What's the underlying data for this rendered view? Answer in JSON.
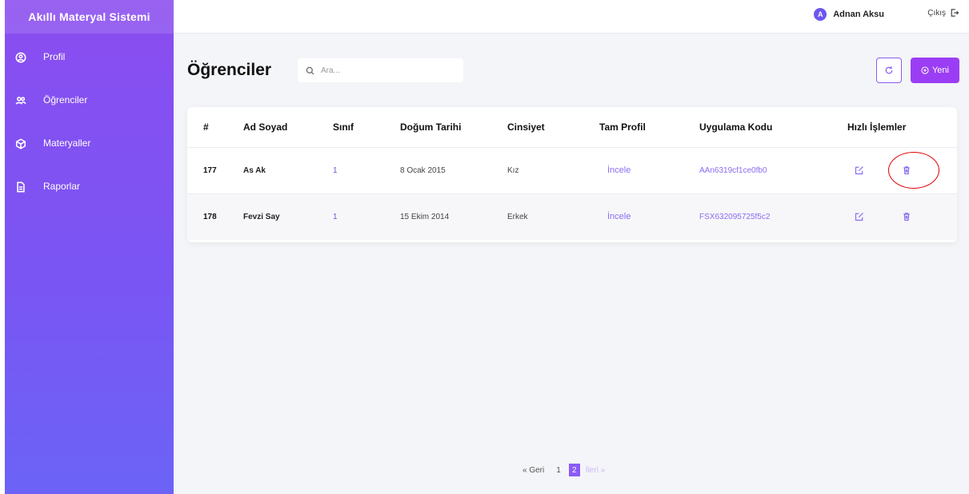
{
  "app": {
    "brand": "Akıllı Materyal Sistemi"
  },
  "sidebar": {
    "items": [
      {
        "label": "Profil",
        "icon": "user-circle-icon"
      },
      {
        "label": "Öğrenciler",
        "icon": "users-icon"
      },
      {
        "label": "Materyaller",
        "icon": "box-icon"
      },
      {
        "label": "Raporlar",
        "icon": "document-icon"
      }
    ]
  },
  "topbar": {
    "user_initial": "A",
    "user_name": "Adnan Aksu",
    "logout_label": "Çıkış"
  },
  "page": {
    "title": "Öğrenciler",
    "search_placeholder": "Ara...",
    "new_button": "Yeni"
  },
  "table": {
    "headers": [
      "#",
      "Ad Soyad",
      "Sınıf",
      "Doğum Tarihi",
      "Cinsiyet",
      "Tam Profil",
      "Uygulama Kodu",
      "Hızlı İşlemler"
    ],
    "rows": [
      {
        "id": "177",
        "name": "As Ak",
        "class": "1",
        "dob": "8 Ocak 2015",
        "gender": "Kız",
        "profile_link": "İncele",
        "code": "AAn6319cf1ce0fb0"
      },
      {
        "id": "178",
        "name": "Fevzi Say",
        "class": "1",
        "dob": "15 Ekim 2014",
        "gender": "Erkek",
        "profile_link": "İncele",
        "code": "FSX632095725f5c2"
      }
    ]
  },
  "pagination": {
    "prev": "« Geri",
    "pages": [
      "1",
      "2"
    ],
    "current": "2",
    "next": "İleri »"
  },
  "colors": {
    "accent": "#8b5cf6",
    "sidebar_top": "#8b4df0",
    "sidebar_bottom": "#6c63f6",
    "highlight": "#e00000"
  }
}
